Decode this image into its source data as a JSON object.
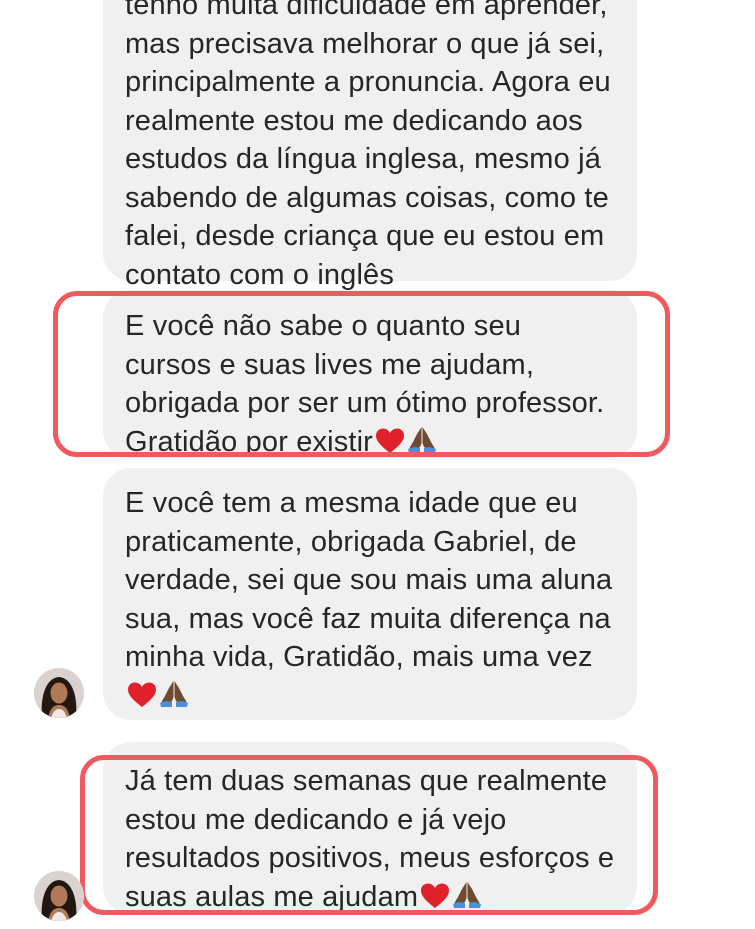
{
  "conversation": {
    "messages": [
      {
        "text": "tenho muita dificuldade em aprender, mas precisava melhorar o que já sei, principalmente a pronuncia. Agora eu realmente estou me dedicando aos estudos da língua inglesa, mesmo já sabendo de algumas coisas, como te falei, desde criança que eu estou em contato com o inglês",
        "emoji": []
      },
      {
        "text": "E você não sabe o quanto seu cursos e suas lives me ajudam, obrigada por ser um ótimo professor. Gratidão por existir",
        "emoji": [
          "red-heart",
          "folded-hands"
        ]
      },
      {
        "text": "E você tem a mesma idade que eu praticamente, obrigada Gabriel, de verdade, sei que sou mais uma aluna sua, mas você faz muita diferença na minha vida, Gratidão, mais uma vez",
        "emoji": [
          "red-heart",
          "folded-hands"
        ]
      },
      {
        "text": "Já tem duas semanas que realmente estou me dedicando e já vejo resultados positivos, meus esforços e suas aulas me ajudam",
        "emoji": [
          "red-heart",
          "folded-hands"
        ]
      }
    ]
  },
  "colors": {
    "bubble": "#f0f0f0",
    "text": "#262626",
    "highlight": "#f05a5e"
  }
}
